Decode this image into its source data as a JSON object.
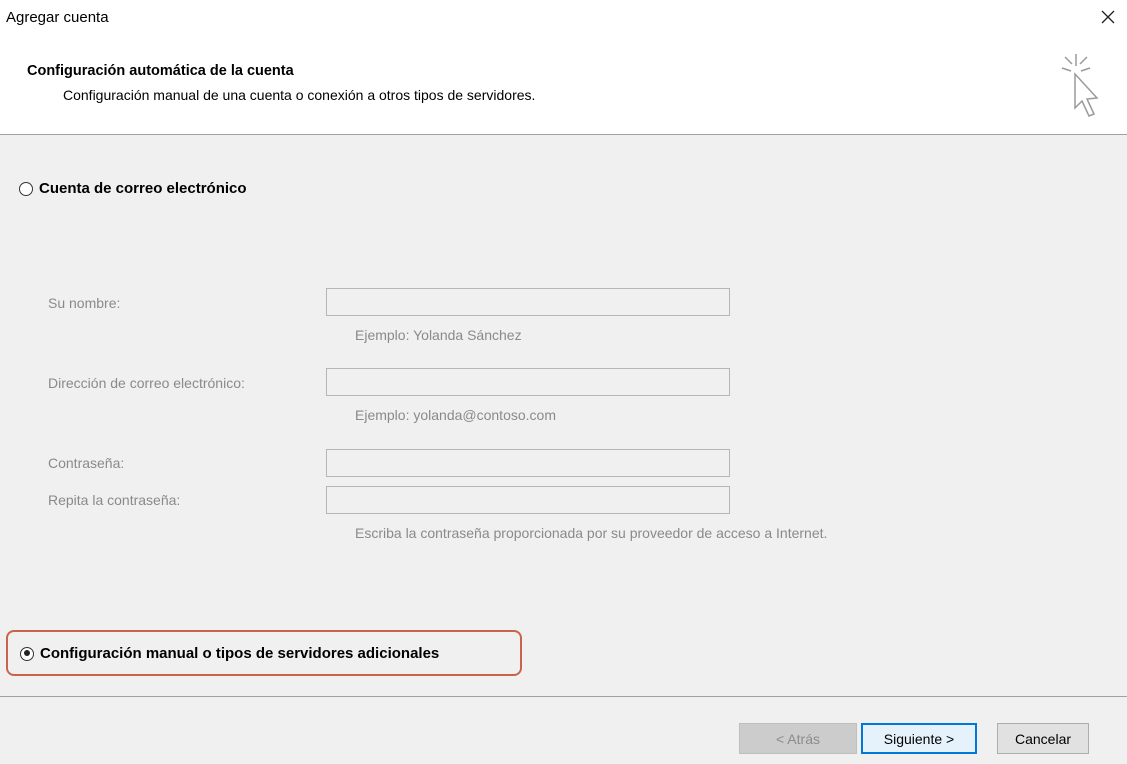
{
  "window": {
    "title": "Agregar cuenta"
  },
  "header": {
    "title": "Configuración automática de la cuenta",
    "subtitle": "Configuración manual de una cuenta o conexión a otros tipos de servidores."
  },
  "options": {
    "email_account": {
      "label": "Cuenta de correo electrónico",
      "selected": false
    },
    "manual_setup": {
      "label": "Configuración manual o tipos de servidores adicionales",
      "selected": true
    }
  },
  "form": {
    "name_label": "Su nombre:",
    "name_value": "",
    "name_hint": "Ejemplo: Yolanda Sánchez",
    "email_label": "Dirección de correo electrónico:",
    "email_value": "",
    "email_hint": "Ejemplo: yolanda@contoso.com",
    "password_label": "Contraseña:",
    "password_value": "",
    "password_repeat_label": "Repita la contraseña:",
    "password_repeat_value": "",
    "password_hint": "Escriba la contraseña proporcionada por su proveedor de acceso a Internet."
  },
  "buttons": {
    "back": "< Atrás",
    "next": "Siguiente >",
    "cancel": "Cancelar"
  },
  "colors": {
    "highlight_border": "#c8644a",
    "primary_border": "#0078d7"
  }
}
